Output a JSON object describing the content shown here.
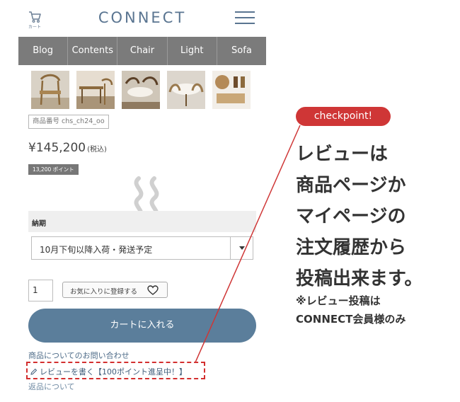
{
  "header": {
    "cart_label": "カート",
    "logo": "CONNECT"
  },
  "nav": {
    "items": [
      {
        "label": "Blog"
      },
      {
        "label": "Contents"
      },
      {
        "label": "Chair"
      },
      {
        "label": "Light"
      },
      {
        "label": "Sofa"
      }
    ]
  },
  "product": {
    "sku": "商品番号 chs_ch24_oo",
    "price": "¥145,200",
    "tax_label": "(税込)",
    "points": "13,200 ポイント"
  },
  "delivery": {
    "label": "納期",
    "value": "10月下旬以降入荷・発送予定"
  },
  "purchase": {
    "quantity": "1",
    "favorite_label": "お気に入りに登録する",
    "cart_button": "カートに入れる"
  },
  "links": {
    "inquiry": "商品についてのお問い合わせ",
    "review": "レビューを書く【100ポイント進呈中！】",
    "returns": "返品について"
  },
  "annotation": {
    "badge": "checkpoint!",
    "headline_lines": [
      "レビューは",
      "商品ページか",
      "マイページの",
      "注文履歴から",
      "投稿出来ます。"
    ],
    "note_lines": [
      "※レビュー投稿は",
      "CONNECT会員様のみ"
    ],
    "accent_color": "#cf3636"
  },
  "colors": {
    "brand": "#5a7591",
    "nav_bg": "#7b7b7b",
    "cart_button": "#5b7e9b"
  }
}
